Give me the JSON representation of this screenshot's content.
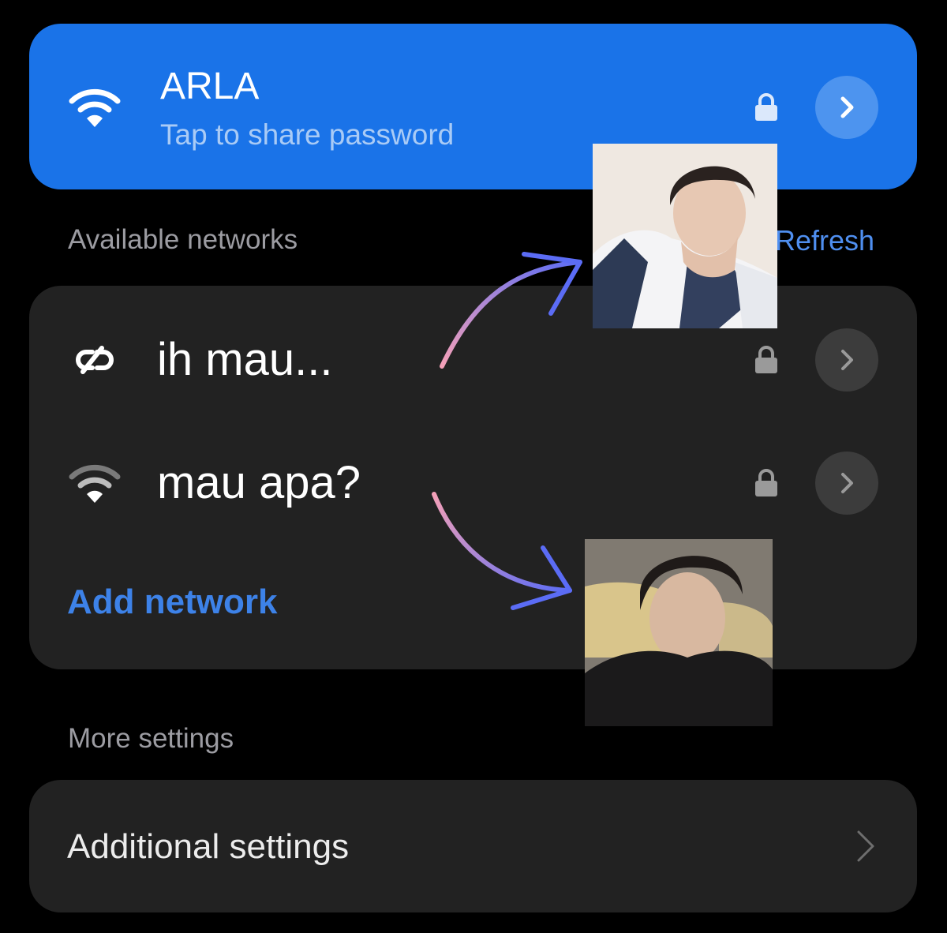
{
  "connected": {
    "name": "ARLA",
    "subtitle": "Tap to share password"
  },
  "available": {
    "label": "Available networks",
    "refresh": "Refresh",
    "networks": [
      {
        "name": "ih mau...",
        "icon": "link-icon"
      },
      {
        "name": "mau apa?",
        "icon": "wifi-icon"
      }
    ],
    "add_network": "Add network"
  },
  "more": {
    "label": "More settings",
    "additional": "Additional settings"
  },
  "colors": {
    "background": "#000000",
    "connected_card": "#1a73e8",
    "card": "#222222",
    "accent": "#3d82e8"
  }
}
